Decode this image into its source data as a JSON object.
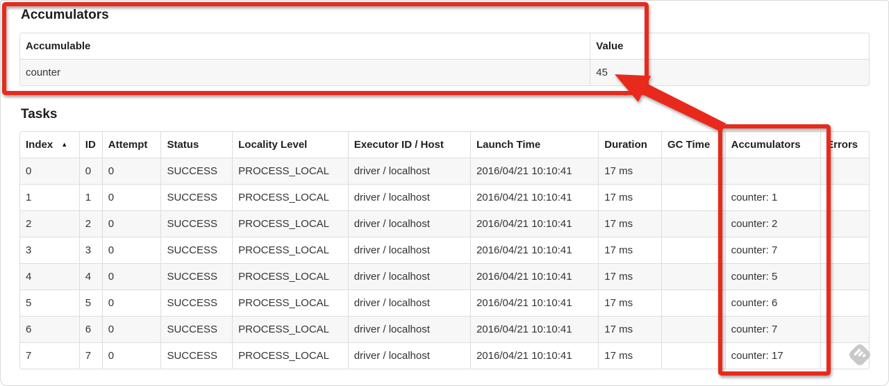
{
  "accumulators_section": {
    "title": "Accumulators",
    "table": {
      "headers": [
        "Accumulable",
        "Value"
      ],
      "rows": [
        [
          "counter",
          "45"
        ]
      ]
    }
  },
  "tasks_section": {
    "title": "Tasks",
    "table": {
      "headers": [
        "Index",
        "ID",
        "Attempt",
        "Status",
        "Locality Level",
        "Executor ID / Host",
        "Launch Time",
        "Duration",
        "GC Time",
        "Accumulators",
        "Errors"
      ],
      "sort_icon": "▲",
      "sorted_column": "Index",
      "rows": [
        [
          "0",
          "0",
          "0",
          "SUCCESS",
          "PROCESS_LOCAL",
          "driver / localhost",
          "2016/04/21 10:10:41",
          "17 ms",
          "",
          "",
          ""
        ],
        [
          "1",
          "1",
          "0",
          "SUCCESS",
          "PROCESS_LOCAL",
          "driver / localhost",
          "2016/04/21 10:10:41",
          "17 ms",
          "",
          "counter: 1",
          ""
        ],
        [
          "2",
          "2",
          "0",
          "SUCCESS",
          "PROCESS_LOCAL",
          "driver / localhost",
          "2016/04/21 10:10:41",
          "17 ms",
          "",
          "counter: 2",
          ""
        ],
        [
          "3",
          "3",
          "0",
          "SUCCESS",
          "PROCESS_LOCAL",
          "driver / localhost",
          "2016/04/21 10:10:41",
          "17 ms",
          "",
          "counter: 7",
          ""
        ],
        [
          "4",
          "4",
          "0",
          "SUCCESS",
          "PROCESS_LOCAL",
          "driver / localhost",
          "2016/04/21 10:10:41",
          "17 ms",
          "",
          "counter: 5",
          ""
        ],
        [
          "5",
          "5",
          "0",
          "SUCCESS",
          "PROCESS_LOCAL",
          "driver / localhost",
          "2016/04/21 10:10:41",
          "17 ms",
          "",
          "counter: 6",
          ""
        ],
        [
          "6",
          "6",
          "0",
          "SUCCESS",
          "PROCESS_LOCAL",
          "driver / localhost",
          "2016/04/21 10:10:41",
          "17 ms",
          "",
          "counter: 7",
          ""
        ],
        [
          "7",
          "7",
          "0",
          "SUCCESS",
          "PROCESS_LOCAL",
          "driver / localhost",
          "2016/04/21 10:10:41",
          "17 ms",
          "",
          "counter: 17",
          ""
        ]
      ]
    }
  },
  "annotations": {
    "color": "#e8291c"
  },
  "watermark_colors": {
    "badge": "#c9c9c9",
    "glyph": "#ffffff"
  }
}
